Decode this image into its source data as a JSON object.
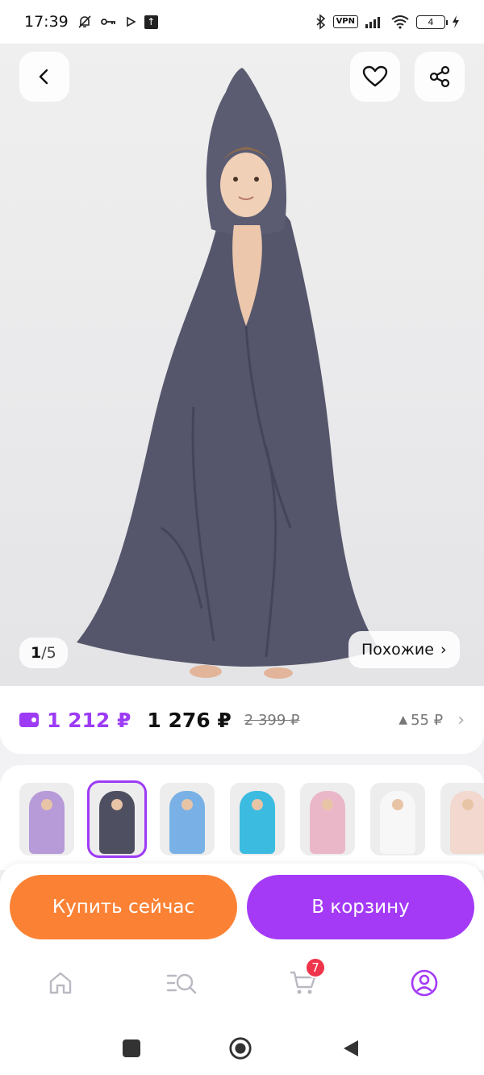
{
  "status_bar": {
    "time": "17:39",
    "vpn": "VPN",
    "battery": "4",
    "icons": [
      "mute-bell-icon",
      "key-icon",
      "play-icon",
      "upload-icon",
      "bluetooth-icon",
      "signal-icon",
      "wifi-icon",
      "charging-icon"
    ]
  },
  "gallery": {
    "counter_current": "1",
    "counter_sep": "/",
    "counter_total": "5",
    "similar_label": "Похожие",
    "similar_chevron": "›"
  },
  "price": {
    "wallet_price": "1 212 ₽",
    "current_price": "1 276 ₽",
    "old_price": "2 399 ₽",
    "diff_arrow": "▲",
    "diff": "55 ₽",
    "chevron": "›"
  },
  "variants": [
    {
      "color": "#b79ad8",
      "selected": false
    },
    {
      "color": "#4f4f62",
      "selected": true
    },
    {
      "color": "#79b1e6",
      "selected": false
    },
    {
      "color": "#3bbbe0",
      "selected": false
    },
    {
      "color": "#eab7c9",
      "selected": false
    },
    {
      "color": "#f7f7f7",
      "selected": false
    },
    {
      "color": "#f2d8cf",
      "selected": false
    }
  ],
  "actions": {
    "buy_now": "Купить сейчас",
    "add_to_cart": "В корзину"
  },
  "bottom_nav": {
    "cart_badge": "7",
    "active_color": "#a43af6",
    "items": [
      "home-icon",
      "catalog-search-icon",
      "cart-icon",
      "profile-icon"
    ]
  },
  "colors": {
    "accent_purple": "#a43af6",
    "accent_orange": "#fb8235",
    "towel": "#55566b"
  }
}
